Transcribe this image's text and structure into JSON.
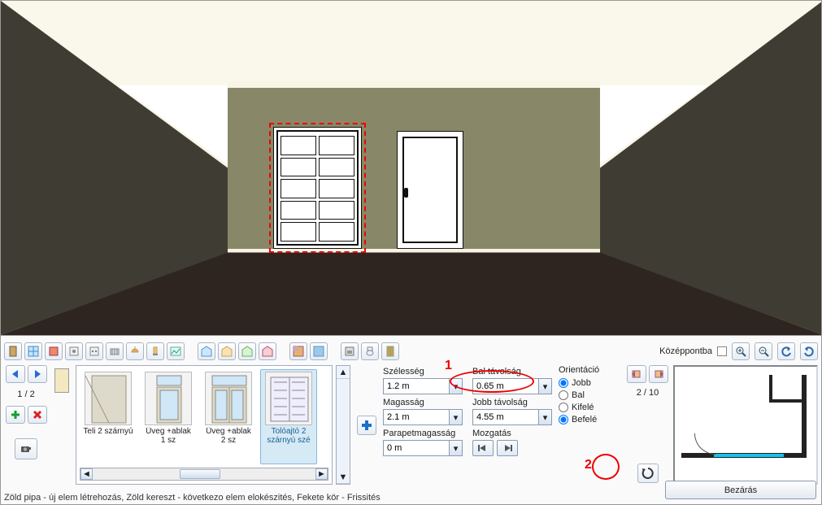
{
  "toolbar": {
    "center_label": "Középpontba"
  },
  "nav": {
    "page": "1 / 2"
  },
  "mini_door_icons": [
    "door-mini-1",
    "black-circle"
  ],
  "gallery": {
    "items": [
      {
        "label": "Teli 2 szárnyú"
      },
      {
        "label": "Üveg +ablak 1 sz"
      },
      {
        "label": "Üveg +ablak 2 sz"
      },
      {
        "label": "Tolóajtó 2 szárnyú szé"
      }
    ],
    "selected_index": 3
  },
  "params": {
    "width_label": "Szélesség",
    "width_value": "1.2 m",
    "leftdist_label": "Bal távolság",
    "leftdist_value": "0.65 m",
    "height_label": "Magasság",
    "height_value": "2.1 m",
    "rightdist_label": "Jobb távolság",
    "rightdist_value": "4.55 m",
    "parapet_label": "Parapetmagasság",
    "parapet_value": "0 m",
    "move_label": "Mozgatás"
  },
  "orientation": {
    "title": "Orientáció",
    "options": [
      "Jobb",
      "Bal",
      "Kifelé",
      "Befelé"
    ],
    "selected1": "Jobb",
    "selected2": "Befelé"
  },
  "side_nav": {
    "page": "2 / 10"
  },
  "annotations": {
    "one": "1",
    "two": "2"
  },
  "status": "Zöld pipa - új elem létrehozás, Zöld kereszt - következo elem elokészités, Fekete kör - Frissités",
  "close_label": "Bezárás"
}
